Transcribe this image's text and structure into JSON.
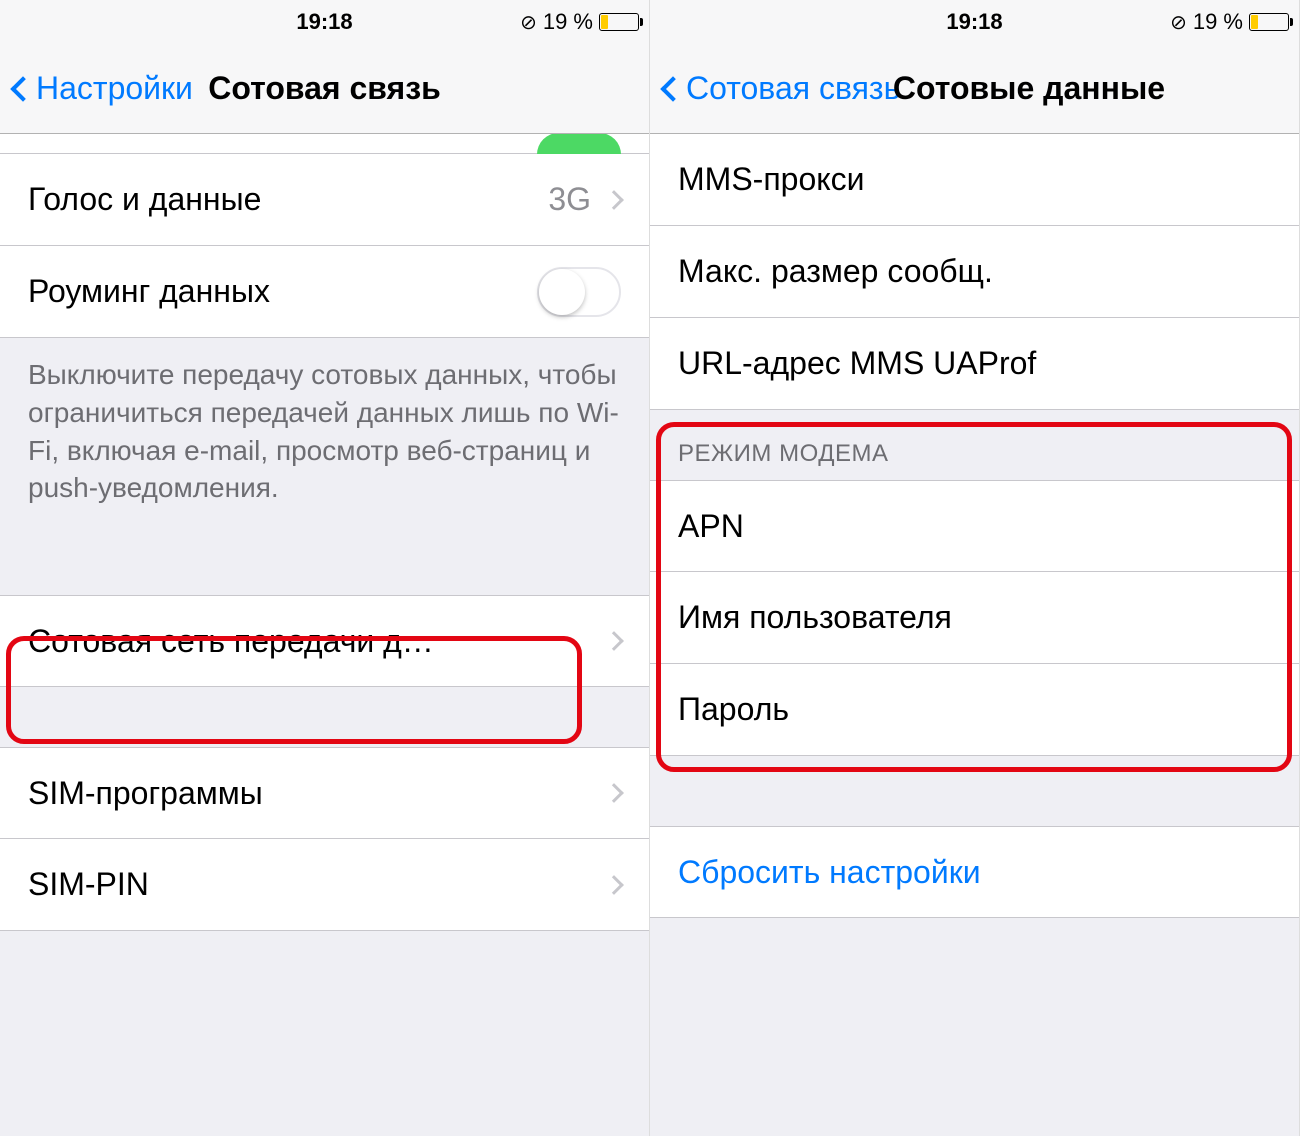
{
  "status": {
    "time": "19:18",
    "lock_glyph": "⊘",
    "battery_text": "19 %"
  },
  "left": {
    "nav_back": "Настройки",
    "nav_title": "Сотовая связь",
    "rows": {
      "voice_data_label": "Голос и данные",
      "voice_data_value": "3G",
      "roaming_label": "Роуминг данных",
      "footer": "Выключите передачу сотовых данных, чтобы ограничиться передачей данных лишь по Wi-Fi, включая e-mail, просмотр веб-страниц и push-уведомления.",
      "cellular_net_label": "Сотовая сеть передачи д…",
      "sim_apps_label": "SIM-программы",
      "sim_pin_label": "SIM-PIN"
    }
  },
  "right": {
    "nav_back": "Сотовая связь",
    "nav_title": "Сотовые данные",
    "rows": {
      "mms_proxy": "MMS-прокси",
      "mms_max_size": "Макс. размер сообщ.",
      "mms_uaprof": "URL-адрес MMS UAProf"
    },
    "modem_header": "РЕЖИМ МОДЕМА",
    "modem_rows": {
      "apn": "APN",
      "username": "Имя пользователя",
      "password": "Пароль"
    },
    "reset_label": "Сбросить настройки"
  }
}
